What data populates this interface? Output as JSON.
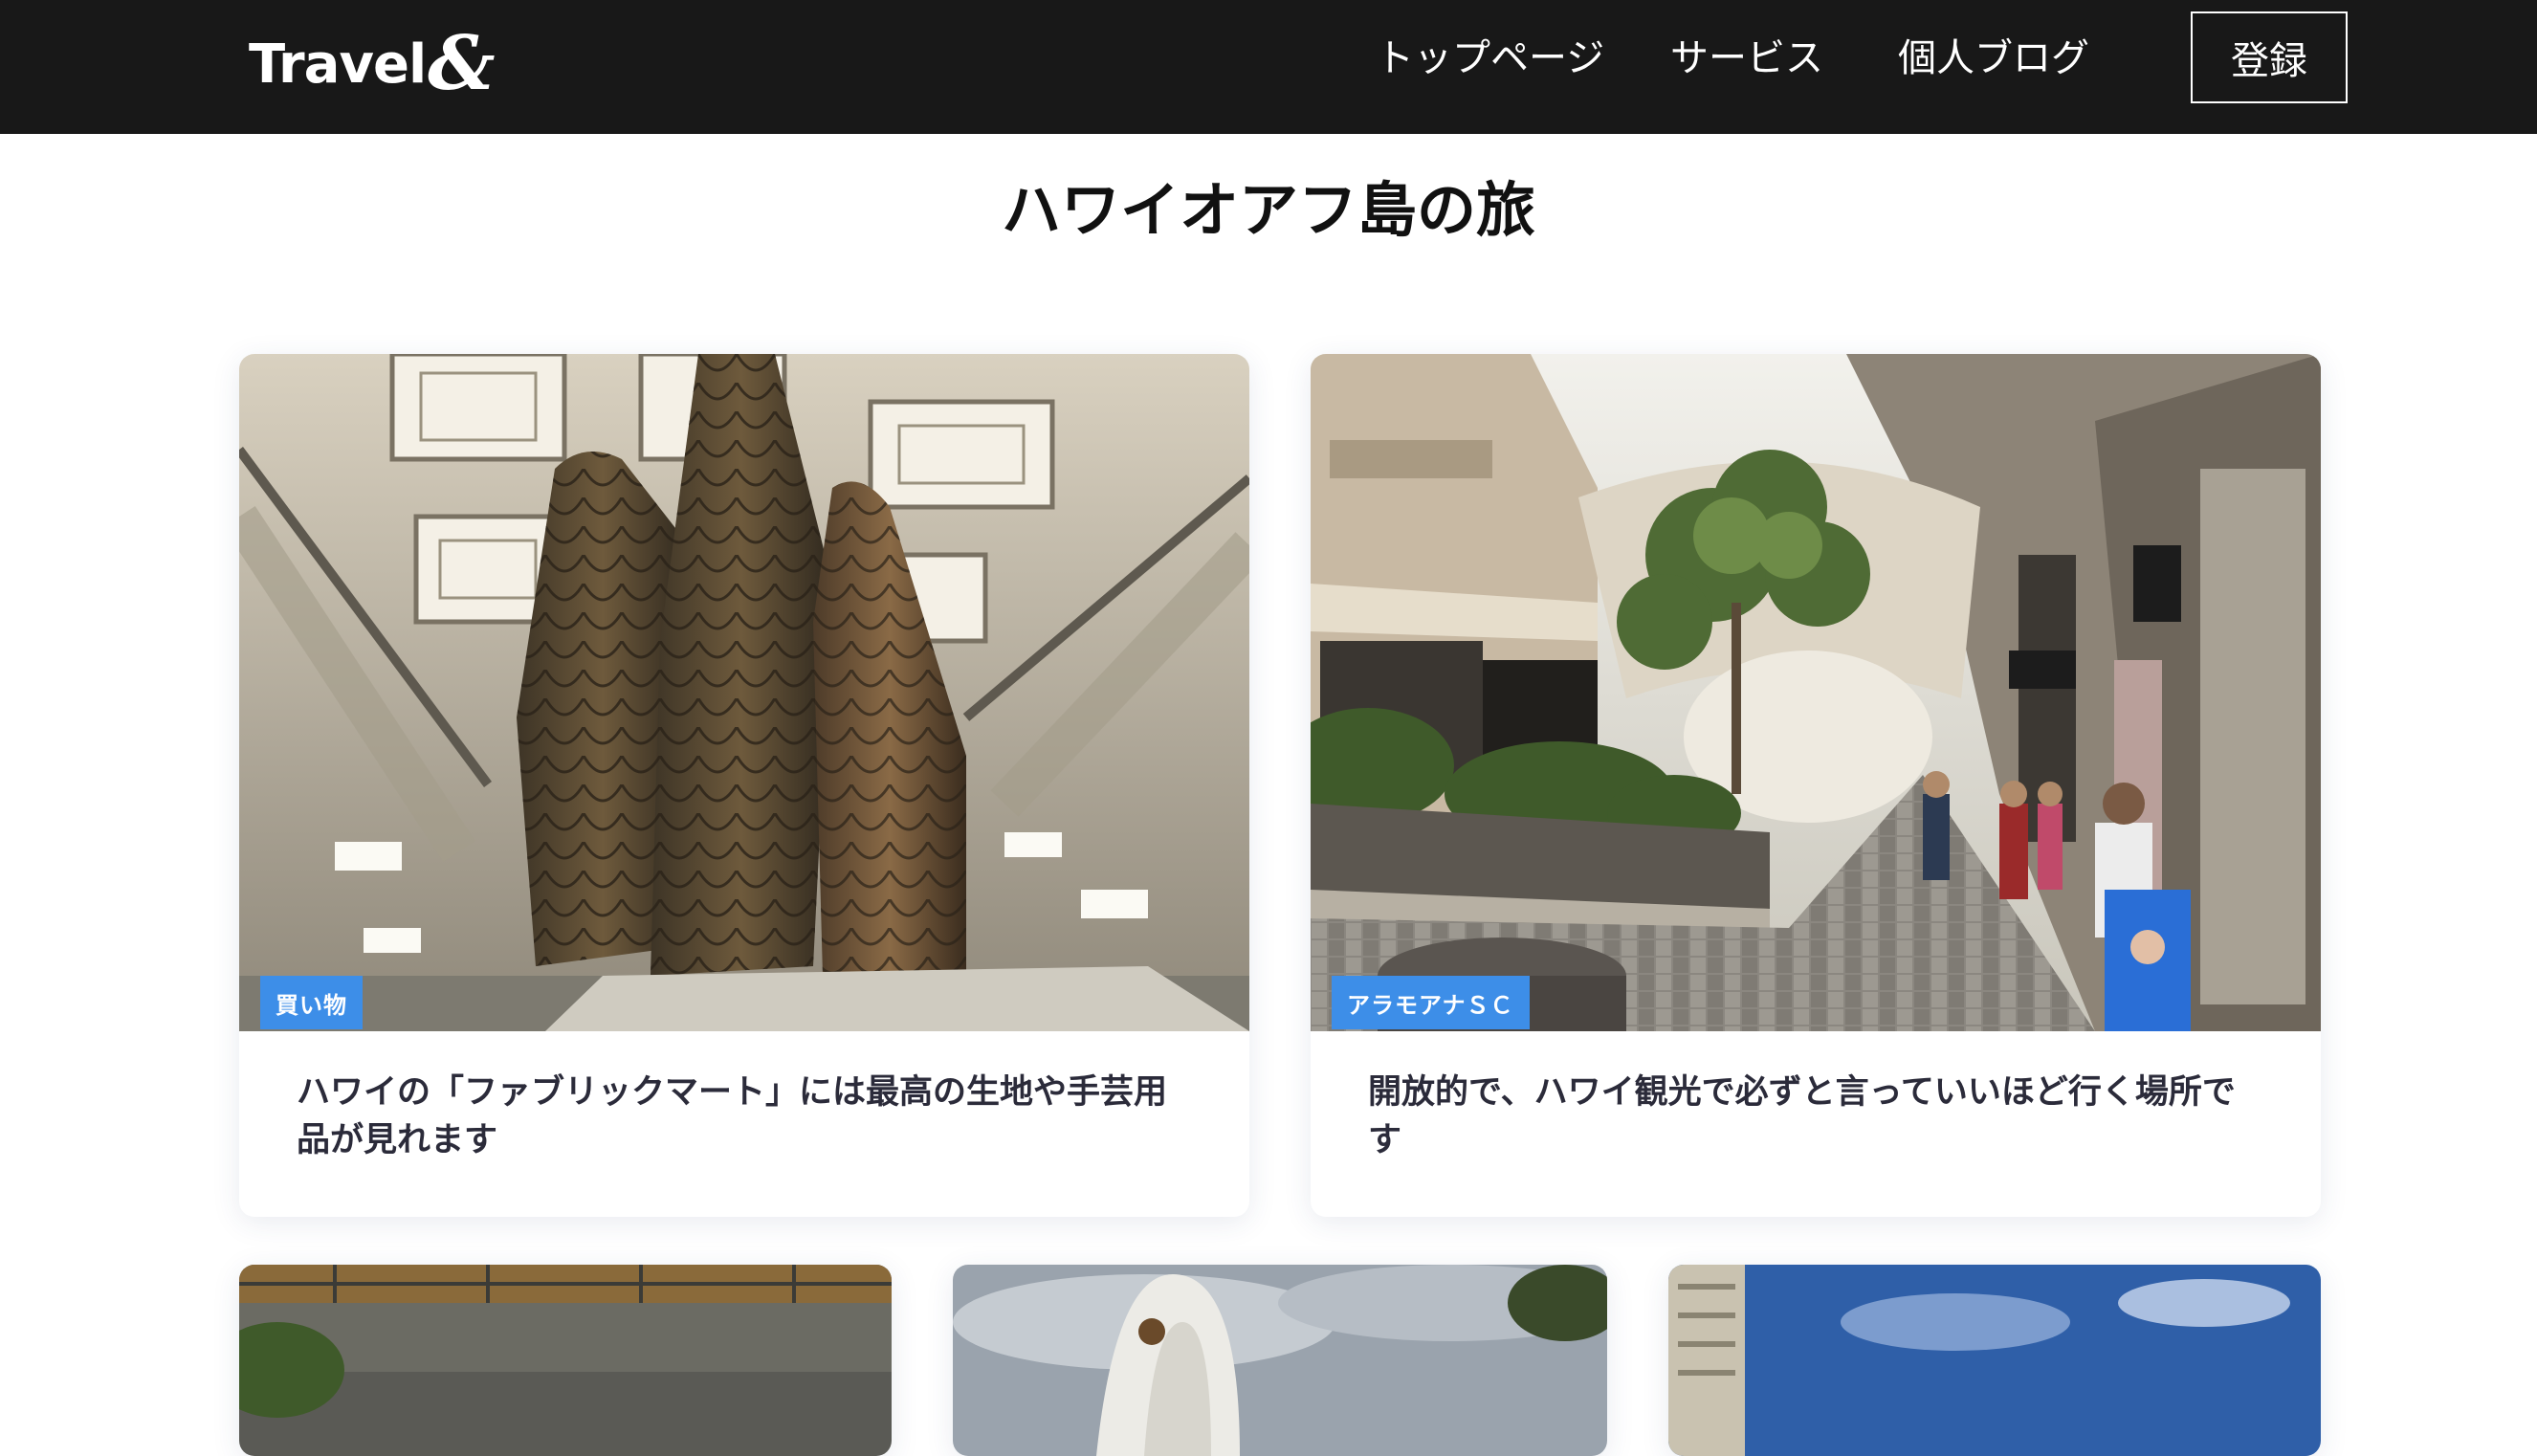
{
  "header": {
    "logo_text": "Travel",
    "logo_amp": "&",
    "nav": [
      {
        "label": "トップページ"
      },
      {
        "label": "サービス"
      },
      {
        "label": "個人ブログ"
      }
    ],
    "register_label": "登録"
  },
  "page": {
    "title": "ハワイオアフ島の旅"
  },
  "cards": [
    {
      "badge": "買い物",
      "title": "ハワイの「ファブリックマート」には最高の生地や手芸用品が見れます"
    },
    {
      "badge": "アラモアナＳＣ",
      "title": "開放的で、ハワイ観光で必ずと言っていいほど行く場所です"
    }
  ],
  "colors": {
    "header_bg": "#181818",
    "badge_bg": "#3d8ee8",
    "card_title": "#2b2b3a"
  }
}
